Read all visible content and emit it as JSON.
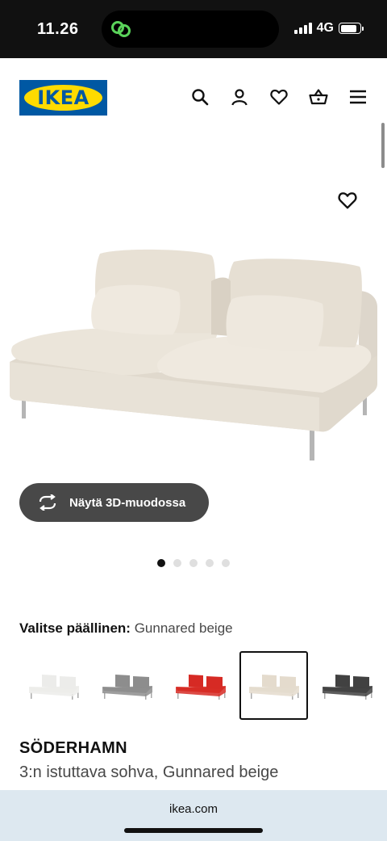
{
  "status_bar": {
    "time": "11.26",
    "network": "4G",
    "battery_level": 0.85
  },
  "header": {
    "logo_text": "IKEA",
    "brand_colors": {
      "blue": "#0058a3",
      "yellow": "#ffdb00"
    },
    "icons": [
      "search-icon",
      "account-icon",
      "heart-icon",
      "basket-icon",
      "menu-icon"
    ]
  },
  "gallery": {
    "view_3d_label": "Näytä 3D-muodossa",
    "dot_count": 5,
    "active_dot": 1
  },
  "cover": {
    "label": "Valitse päällinen:",
    "selected_name": "Gunnared beige",
    "swatches": [
      {
        "color": "#ececea",
        "selected": false
      },
      {
        "color": "#8d8d8d",
        "selected": false
      },
      {
        "color": "#d62a24",
        "selected": false
      },
      {
        "color": "#e4dbcd",
        "selected": true
      },
      {
        "color": "#414141",
        "selected": false
      }
    ]
  },
  "product": {
    "name": "SÖDERHAMN",
    "description": "3:n istuttava sohva, Gunnared beige"
  },
  "browser": {
    "url": "ikea.com"
  }
}
